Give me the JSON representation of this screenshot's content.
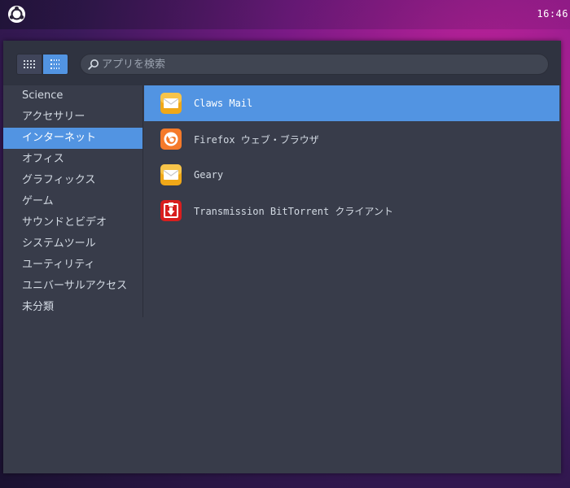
{
  "topbar": {
    "logo_icon": "ubuntu-budgie-logo-icon",
    "clock": "16:46"
  },
  "menu": {
    "view_toggle": {
      "grid_icon": "grid-view-icon",
      "list_icon": "list-view-icon",
      "active": "list"
    },
    "search": {
      "placeholder": "アプリを検索",
      "value": ""
    },
    "categories": [
      {
        "label": "Science"
      },
      {
        "label": "アクセサリー"
      },
      {
        "label": "インターネット"
      },
      {
        "label": "オフィス"
      },
      {
        "label": "グラフィックス"
      },
      {
        "label": "ゲーム"
      },
      {
        "label": "サウンドとビデオ"
      },
      {
        "label": "システムツール"
      },
      {
        "label": "ユーティリティ"
      },
      {
        "label": "ユニバーサルアクセス"
      },
      {
        "label": "未分類"
      }
    ],
    "selected_category": "インターネット",
    "apps": [
      {
        "label": "Claws Mail",
        "icon": "mail-envelope-icon"
      },
      {
        "label": "Firefox ウェブ・ブラウザ",
        "icon": "firefox-icon"
      },
      {
        "label": "Geary",
        "icon": "mail-envelope-icon"
      },
      {
        "label": "Transmission BitTorrent クライアント",
        "icon": "transmission-icon"
      }
    ],
    "selected_app": "Claws Mail"
  },
  "colors": {
    "accent": "#5294e2",
    "panel_bg": "#383c4a",
    "toolbar_bg": "#2f3340",
    "text": "#d3dae3"
  }
}
